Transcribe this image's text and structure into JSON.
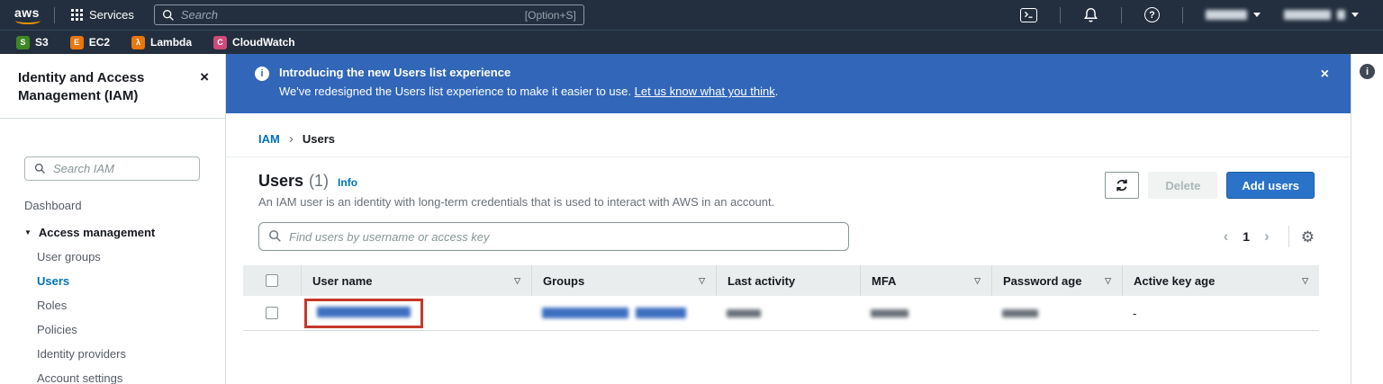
{
  "topnav": {
    "logo": "aws",
    "services_label": "Services",
    "search_placeholder": "Search",
    "search_shortcut": "[Option+S]",
    "account_menus_redacted": true
  },
  "favorites": {
    "items": [
      {
        "label": "S3",
        "glyph": "S",
        "color": "#3e8727"
      },
      {
        "label": "EC2",
        "glyph": "E",
        "color": "#e8770d"
      },
      {
        "label": "Lambda",
        "glyph": "λ",
        "color": "#e8770d"
      },
      {
        "label": "CloudWatch",
        "glyph": "C",
        "color": "#cf4a7a"
      }
    ]
  },
  "sidebar": {
    "title": "Identity and Access Management (IAM)",
    "search_placeholder": "Search IAM",
    "dashboard_label": "Dashboard",
    "section_label": "Access management",
    "items": [
      {
        "label": "User groups",
        "active": false
      },
      {
        "label": "Users",
        "active": true
      },
      {
        "label": "Roles",
        "active": false
      },
      {
        "label": "Policies",
        "active": false
      },
      {
        "label": "Identity providers",
        "active": false
      },
      {
        "label": "Account settings",
        "active": false
      }
    ]
  },
  "banner": {
    "title": "Introducing the new Users list experience",
    "message": "We've redesigned the Users list experience to make it easier to use. ",
    "link_label": "Let us know what you think",
    "suffix": "."
  },
  "breadcrumb": {
    "root": "IAM",
    "current": "Users"
  },
  "panel": {
    "title": "Users",
    "count": "(1)",
    "info_label": "Info",
    "description": "An IAM user is an identity with long-term credentials that is used to interact with AWS in an account.",
    "delete_label": "Delete",
    "add_users_label": "Add users",
    "filter_placeholder": "Find users by username or access key",
    "page_number": "1"
  },
  "table": {
    "columns": [
      {
        "label": "User name",
        "sortable": true
      },
      {
        "label": "Groups",
        "sortable": true
      },
      {
        "label": "Last activity",
        "sortable": false
      },
      {
        "label": "MFA",
        "sortable": true
      },
      {
        "label": "Password age",
        "sortable": true
      },
      {
        "label": "Active key age",
        "sortable": true
      }
    ],
    "row": {
      "user_name_redacted": true,
      "groups_redacted": true,
      "last_activity_redacted": true,
      "mfa_redacted": true,
      "password_age_redacted": true,
      "active_key_age": "-",
      "annotation": "red highlight box around user name"
    }
  },
  "colors": {
    "nav_dark": "#232f3e",
    "banner_blue": "#3166b8",
    "link_blue": "#0073bb",
    "primary_button_blue": "#2a73c8",
    "annotation_red": "#c5392b",
    "table_header_gray": "#eaeded"
  }
}
